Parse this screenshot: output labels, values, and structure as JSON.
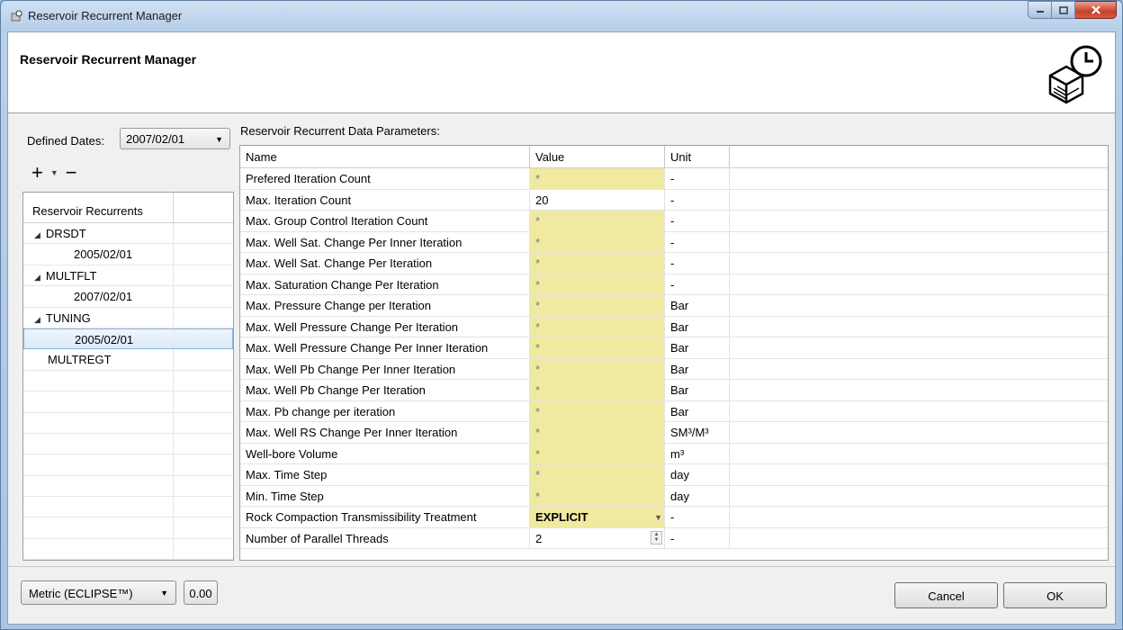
{
  "window": {
    "title": "Reservoir Recurrent Manager",
    "header_title": "Reservoir Recurrent Manager"
  },
  "dates": {
    "label": "Defined Dates:",
    "selected": "2007/02/01"
  },
  "toolbar": {
    "add_symbol": "+",
    "remove_symbol": "−",
    "dropdown_symbol": "▾"
  },
  "tree": {
    "header": "Reservoir Recurrents",
    "rows": [
      {
        "label": "DRSDT",
        "expanded": true,
        "level": 0
      },
      {
        "label": "2005/02/01",
        "level": 1
      },
      {
        "label": "MULTFLT",
        "expanded": true,
        "level": 0
      },
      {
        "label": "2007/02/01",
        "level": 1
      },
      {
        "label": "TUNING",
        "expanded": true,
        "level": 0
      },
      {
        "label": "2005/02/01",
        "level": 1,
        "selected": true
      },
      {
        "label": "MULTREGT",
        "level": 0
      }
    ]
  },
  "params": {
    "section_label": "Reservoir Recurrent Data Parameters:",
    "columns": [
      "Name",
      "Value",
      "Unit"
    ],
    "rows": [
      {
        "name": "Prefered Iteration Count",
        "value": "*",
        "unit": "-",
        "kind": "empty"
      },
      {
        "name": "Max. Iteration Count",
        "value": "20",
        "unit": "-",
        "kind": "filled"
      },
      {
        "name": "Max. Group Control Iteration Count",
        "value": "*",
        "unit": "-",
        "kind": "empty"
      },
      {
        "name": "Max. Well Sat. Change Per Inner Iteration",
        "value": "*",
        "unit": "-",
        "kind": "empty"
      },
      {
        "name": "Max. Well Sat. Change Per Iteration",
        "value": "*",
        "unit": "-",
        "kind": "empty"
      },
      {
        "name": "Max. Saturation Change Per Iteration",
        "value": "*",
        "unit": "-",
        "kind": "empty"
      },
      {
        "name": "Max. Pressure Change per Iteration",
        "value": "*",
        "unit": "Bar",
        "kind": "empty"
      },
      {
        "name": "Max. Well Pressure Change Per Iteration",
        "value": "*",
        "unit": "Bar",
        "kind": "empty"
      },
      {
        "name": "Max. Well Pressure Change Per Inner Iteration",
        "value": "*",
        "unit": "Bar",
        "kind": "empty"
      },
      {
        "name": "Max. Well Pb Change Per Inner Iteration",
        "value": "*",
        "unit": "Bar",
        "kind": "empty"
      },
      {
        "name": "Max. Well Pb Change Per Iteration",
        "value": "*",
        "unit": "Bar",
        "kind": "empty"
      },
      {
        "name": "Max. Pb change per iteration",
        "value": "*",
        "unit": "Bar",
        "kind": "empty"
      },
      {
        "name": "Max. Well RS Change Per Inner Iteration",
        "value": "*",
        "unit": "SM³/M³",
        "kind": "empty"
      },
      {
        "name": "Well-bore Volume",
        "value": "*",
        "unit": "m³",
        "kind": "empty"
      },
      {
        "name": "Max. Time Step",
        "value": "*",
        "unit": "day",
        "kind": "empty"
      },
      {
        "name": "Min. Time Step",
        "value": "*",
        "unit": "day",
        "kind": "empty"
      },
      {
        "name": "Rock Compaction Transmissibility Treatment",
        "value": "EXPLICIT",
        "unit": "-",
        "kind": "combo"
      },
      {
        "name": "Number of Parallel Threads",
        "value": "2",
        "unit": "-",
        "kind": "spin"
      }
    ]
  },
  "footer": {
    "unit_system": "Metric (ECLIPSE™)",
    "zero_label": "0.00",
    "cancel_label": "Cancel",
    "ok_label": "OK"
  },
  "colors": {
    "empty_cell": "#f0e9a0",
    "selection": "#dbe9f8"
  }
}
